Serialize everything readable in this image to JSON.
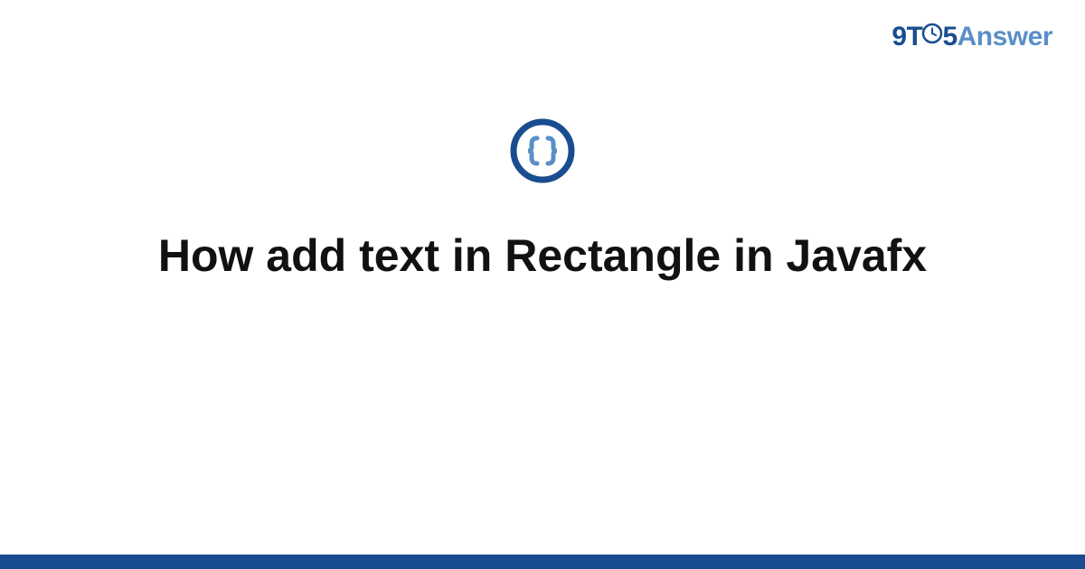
{
  "brand": {
    "nine": "9",
    "t": "T",
    "five": "5",
    "answer": "Answer"
  },
  "icon": {
    "name": "code-braces-icon",
    "ring_color": "#1a4d8f",
    "brace_color": "#5a8fc7"
  },
  "title": "How add text in Rectangle in Javafx",
  "colors": {
    "brand_dark": "#1a4d8f",
    "brand_light": "#5a8fc7",
    "text": "#111111",
    "bg": "#ffffff"
  }
}
